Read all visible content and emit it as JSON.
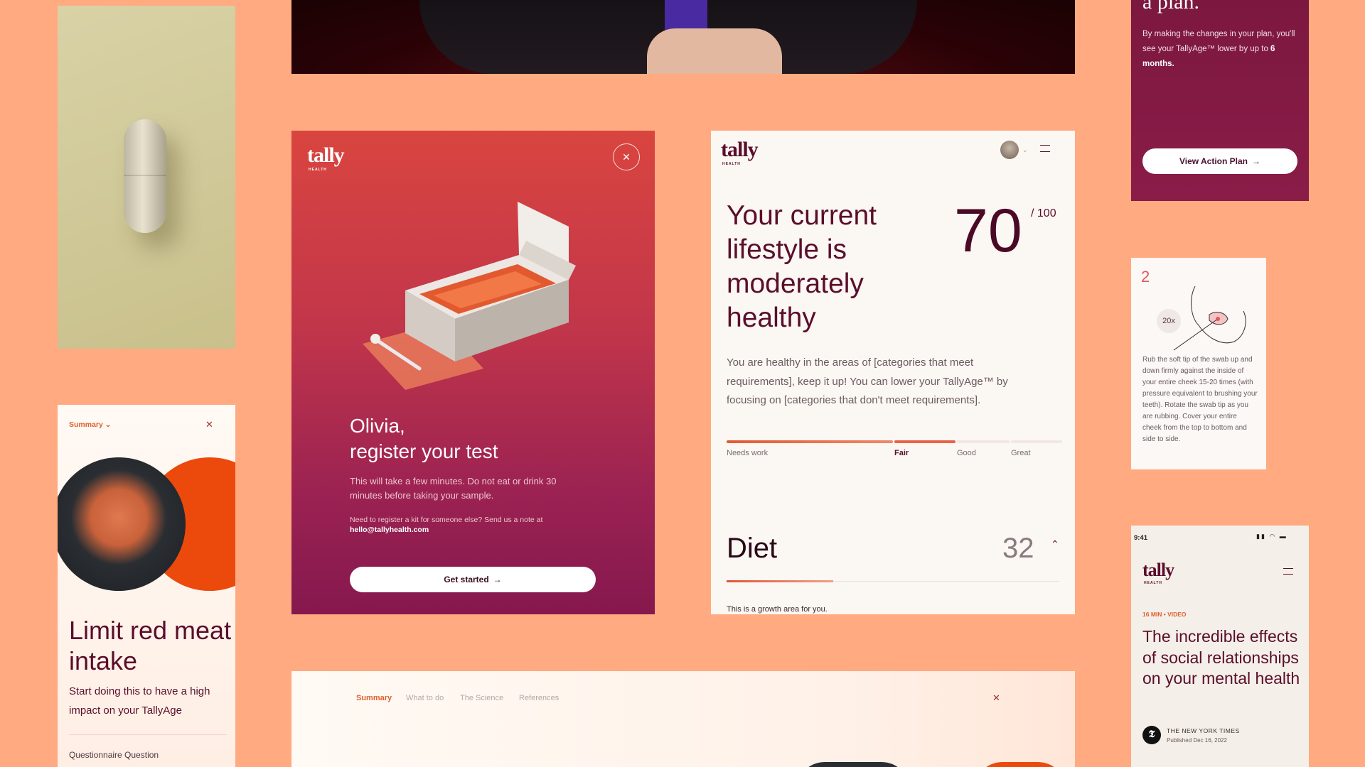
{
  "colors": {
    "background": "#ffaa80",
    "brand_plum": "#5a0e2c",
    "accent_orange": "#e06030",
    "button_white": "#ffffff"
  },
  "action_plan": {
    "title_fragment": "a plan.",
    "text_before": "By making the changes in your plan, you'll see your TallyAge™ lower by up to ",
    "text_strong": "6 months.",
    "button_label": "View Action Plan",
    "button_icon": "arrow-right-icon"
  },
  "register": {
    "logo": "tally",
    "logo_sub": "HEALTH",
    "close_icon": "close-icon",
    "name_line": "Olivia,",
    "title_line": "register your test",
    "description": "This will take a few minutes. Do not eat or drink 30 minutes before taking your sample.",
    "note": "Need to register a kit for someone else? Send us a note at",
    "email": "hello@tallyhealth.com",
    "button_label": "Get started",
    "button_icon": "arrow-right-icon"
  },
  "lifestyle": {
    "logo": "tally",
    "logo_sub": "HEALTH",
    "title": "Your current lifestyle is moderately healthy",
    "score": "70",
    "score_max": "/ 100",
    "description": "You are healthy in the areas of [categories that meet requirements], keep it up! You can lower your TallyAge™ by focusing on [categories that don't meet requirements].",
    "scale": [
      {
        "label": "Needs work",
        "active": false
      },
      {
        "label": "Fair",
        "active": true
      },
      {
        "label": "Good",
        "active": false
      },
      {
        "label": "Great",
        "active": false
      }
    ],
    "diet_title": "Diet",
    "diet_score": "32",
    "diet_subtitle": "This is a growth area for you."
  },
  "summary": {
    "dropdown_label": "Summary",
    "title": "Limit red meat intake",
    "description": "Start doing this to have a high impact on your TallyAge",
    "section_label": "Questionnaire Question"
  },
  "swab": {
    "step": "2",
    "repeat_badge": "20x",
    "instructions": "Rub the soft tip of the swab up and down firmly against the inside of your entire cheek 15-20 times (with pressure equivalent to brushing your teeth). Rotate the swab tip as you are rubbing. Cover your entire cheek from the top to bottom and side to side."
  },
  "article": {
    "status_time": "9:41",
    "logo": "tally",
    "logo_sub": "HEALTH",
    "meta": "16 MIN • VIDEO",
    "title": "The incredible effects of social relationships on your mental health",
    "source": "THE NEW YORK TIMES",
    "published": "Published Dec 16, 2022"
  },
  "tabs": {
    "items": [
      {
        "label": "Summary",
        "active": true
      },
      {
        "label": "What to do",
        "active": false
      },
      {
        "label": "The Science",
        "active": false
      },
      {
        "label": "References",
        "active": false
      }
    ]
  }
}
